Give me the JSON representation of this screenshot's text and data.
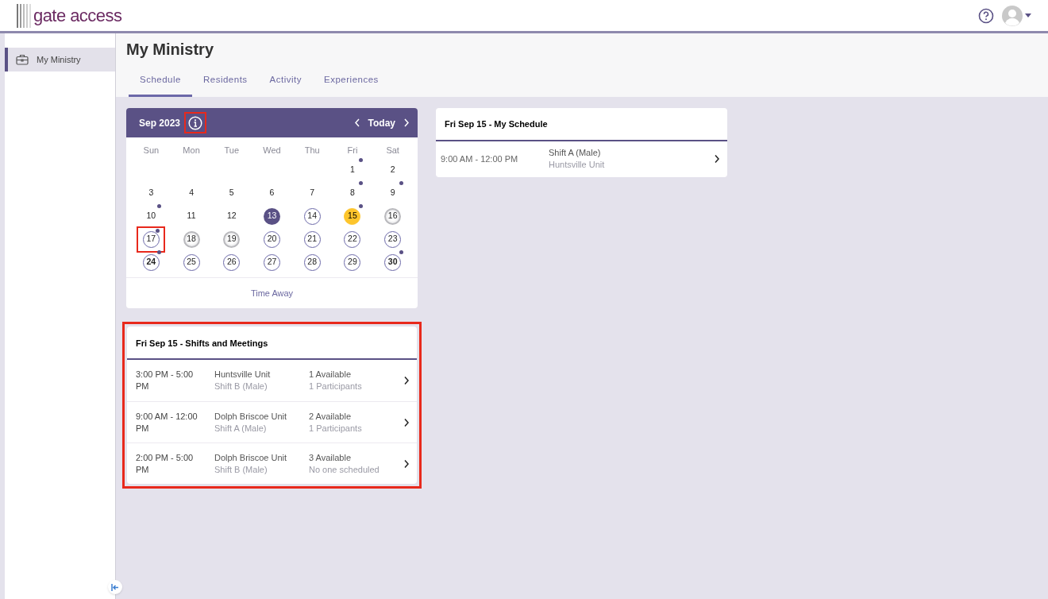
{
  "brand": {
    "name": "gate access"
  },
  "sidebar": {
    "items": [
      {
        "label": "My Ministry",
        "selected": true
      }
    ]
  },
  "page": {
    "title": "My Ministry"
  },
  "tabs": [
    {
      "label": "Schedule",
      "selected": true
    },
    {
      "label": "Residents",
      "selected": false
    },
    {
      "label": "Activity",
      "selected": false
    },
    {
      "label": "Experiences",
      "selected": false
    }
  ],
  "calendar": {
    "month": "Sep 2023",
    "info_highlighted": true,
    "today_button": "Today",
    "weekdays": [
      "Sun",
      "Mon",
      "Tue",
      "Wed",
      "Thu",
      "Fri",
      "Sat"
    ],
    "weeks": [
      [
        {
          "day": "1",
          "kind": "plain",
          "dot": true,
          "bold": false,
          "selected": false,
          "highlighted": false
        },
        {
          "day": "2",
          "kind": "plain",
          "dot": false,
          "bold": false,
          "selected": false,
          "highlighted": false
        }
      ],
      [
        {
          "day": "3",
          "kind": "plain",
          "dot": false,
          "bold": false,
          "selected": false,
          "highlighted": false
        },
        {
          "day": "4",
          "kind": "plain",
          "dot": false,
          "bold": false,
          "selected": false,
          "highlighted": false
        },
        {
          "day": "5",
          "kind": "plain",
          "dot": false,
          "bold": false,
          "selected": false,
          "highlighted": false
        },
        {
          "day": "6",
          "kind": "plain",
          "dot": false,
          "bold": false,
          "selected": false,
          "highlighted": false
        },
        {
          "day": "7",
          "kind": "plain",
          "dot": false,
          "bold": false,
          "selected": false,
          "highlighted": false
        },
        {
          "day": "8",
          "kind": "plain",
          "dot": true,
          "bold": false,
          "selected": false,
          "highlighted": false
        },
        {
          "day": "9",
          "kind": "plain",
          "dot": true,
          "bold": false,
          "selected": false,
          "highlighted": false
        }
      ],
      [
        {
          "day": "10",
          "kind": "plain",
          "dot": true,
          "bold": false,
          "selected": false,
          "highlighted": false
        },
        {
          "day": "11",
          "kind": "plain",
          "dot": false,
          "bold": false,
          "selected": false,
          "highlighted": false
        },
        {
          "day": "12",
          "kind": "plain",
          "dot": false,
          "bold": false,
          "selected": false,
          "highlighted": false
        },
        {
          "day": "13",
          "kind": "filled",
          "dot": false,
          "bold": false,
          "selected": false,
          "highlighted": false
        },
        {
          "day": "14",
          "kind": "ring",
          "dot": false,
          "bold": false,
          "selected": false,
          "highlighted": false
        },
        {
          "day": "15",
          "kind": "ring",
          "dot": true,
          "bold": false,
          "selected": true,
          "highlighted": false
        },
        {
          "day": "16",
          "kind": "grey",
          "dot": false,
          "bold": false,
          "selected": false,
          "highlighted": false
        }
      ],
      [
        {
          "day": "17",
          "kind": "ring",
          "dot": true,
          "bold": false,
          "selected": false,
          "highlighted": true
        },
        {
          "day": "18",
          "kind": "grey",
          "dot": false,
          "bold": false,
          "selected": false,
          "highlighted": false
        },
        {
          "day": "19",
          "kind": "grey",
          "dot": false,
          "bold": false,
          "selected": false,
          "highlighted": false
        },
        {
          "day": "20",
          "kind": "ring",
          "dot": false,
          "bold": false,
          "selected": false,
          "highlighted": false
        },
        {
          "day": "21",
          "kind": "ring",
          "dot": false,
          "bold": false,
          "selected": false,
          "highlighted": false
        },
        {
          "day": "22",
          "kind": "ring",
          "dot": false,
          "bold": false,
          "selected": false,
          "highlighted": false
        },
        {
          "day": "23",
          "kind": "ring",
          "dot": false,
          "bold": false,
          "selected": false,
          "highlighted": false
        }
      ],
      [
        {
          "day": "24",
          "kind": "ring",
          "dot": true,
          "bold": true,
          "selected": false,
          "highlighted": false
        },
        {
          "day": "25",
          "kind": "ring",
          "dot": false,
          "bold": false,
          "selected": false,
          "highlighted": false
        },
        {
          "day": "26",
          "kind": "ring",
          "dot": false,
          "bold": false,
          "selected": false,
          "highlighted": false
        },
        {
          "day": "27",
          "kind": "ring",
          "dot": false,
          "bold": false,
          "selected": false,
          "highlighted": false
        },
        {
          "day": "28",
          "kind": "ring",
          "dot": false,
          "bold": false,
          "selected": false,
          "highlighted": false
        },
        {
          "day": "29",
          "kind": "ring",
          "dot": false,
          "bold": false,
          "selected": false,
          "highlighted": false
        },
        {
          "day": "30",
          "kind": "ring",
          "dot": true,
          "bold": true,
          "selected": false,
          "highlighted": false
        }
      ]
    ],
    "footer_link": "Time Away"
  },
  "shifts": {
    "title": "Fri Sep 15 - Shifts and Meetings",
    "highlighted": true,
    "rows": [
      {
        "time": "3:00 PM - 5:00 PM",
        "unit": "Huntsville Unit",
        "shift": "Shift B (Male)",
        "available": "1 Available",
        "participants": "1 Participants"
      },
      {
        "time": "9:00 AM - 12:00 PM",
        "unit": "Dolph Briscoe Unit",
        "shift": "Shift A (Male)",
        "available": "2 Available",
        "participants": "1 Participants"
      },
      {
        "time": "2:00 PM - 5:00 PM",
        "unit": "Dolph Briscoe Unit",
        "shift": "Shift B (Male)",
        "available": "3 Available",
        "participants": "No one scheduled"
      }
    ]
  },
  "my_schedule": {
    "title": "Fri Sep 15 - My Schedule",
    "rows": [
      {
        "time": "9:00 AM - 12:00 PM",
        "shift": "Shift A (Male)",
        "unit": "Huntsville Unit"
      }
    ]
  }
}
